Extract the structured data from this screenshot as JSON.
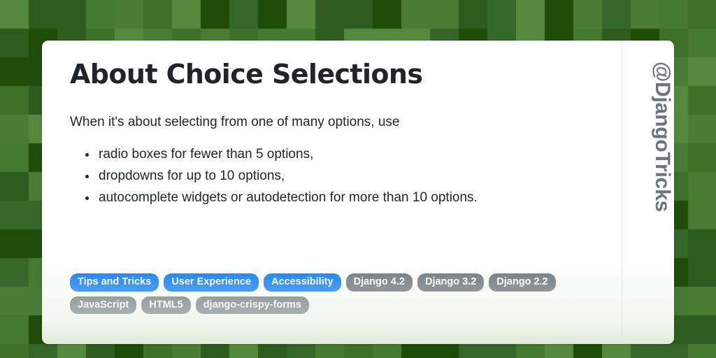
{
  "background": {
    "pattern": "green-checkerboard",
    "cell_size": 41,
    "palette": [
      "#4a7c35",
      "#3d7029",
      "#35662a",
      "#1f4c08",
      "#558a3e",
      "#2d5c1e",
      "#447a31"
    ]
  },
  "card": {
    "title": "About Choice Selections",
    "intro": "When it's about selecting from one of many options, use",
    "bullets": [
      "radio boxes for fewer than 5 options,",
      "dropdowns for up to 10 options,",
      "autocomplete widgets or autodetection for more than 10 options."
    ],
    "side_handle": "@DjangoTricks",
    "tag_rows": [
      [
        {
          "label": "Tips and Tricks",
          "style": "primary"
        },
        {
          "label": "User Experience",
          "style": "primary"
        },
        {
          "label": "Accessibility",
          "style": "primary"
        },
        {
          "label": "Django 4.2",
          "style": "secondary"
        },
        {
          "label": "Django 3.2",
          "style": "secondary"
        },
        {
          "label": "Django 2.2",
          "style": "secondary"
        }
      ],
      [
        {
          "label": "JavaScript",
          "style": "secondary"
        },
        {
          "label": "HTML5",
          "style": "secondary"
        },
        {
          "label": "django-crispy-forms",
          "style": "secondary"
        }
      ]
    ]
  },
  "colors": {
    "primary_tag": "#0d7bf7",
    "secondary_tag": "#6c757d",
    "text": "#212529",
    "handle_text": "#6d7480",
    "divider": "#e3e4ec",
    "card_bg": "#ffffff"
  }
}
